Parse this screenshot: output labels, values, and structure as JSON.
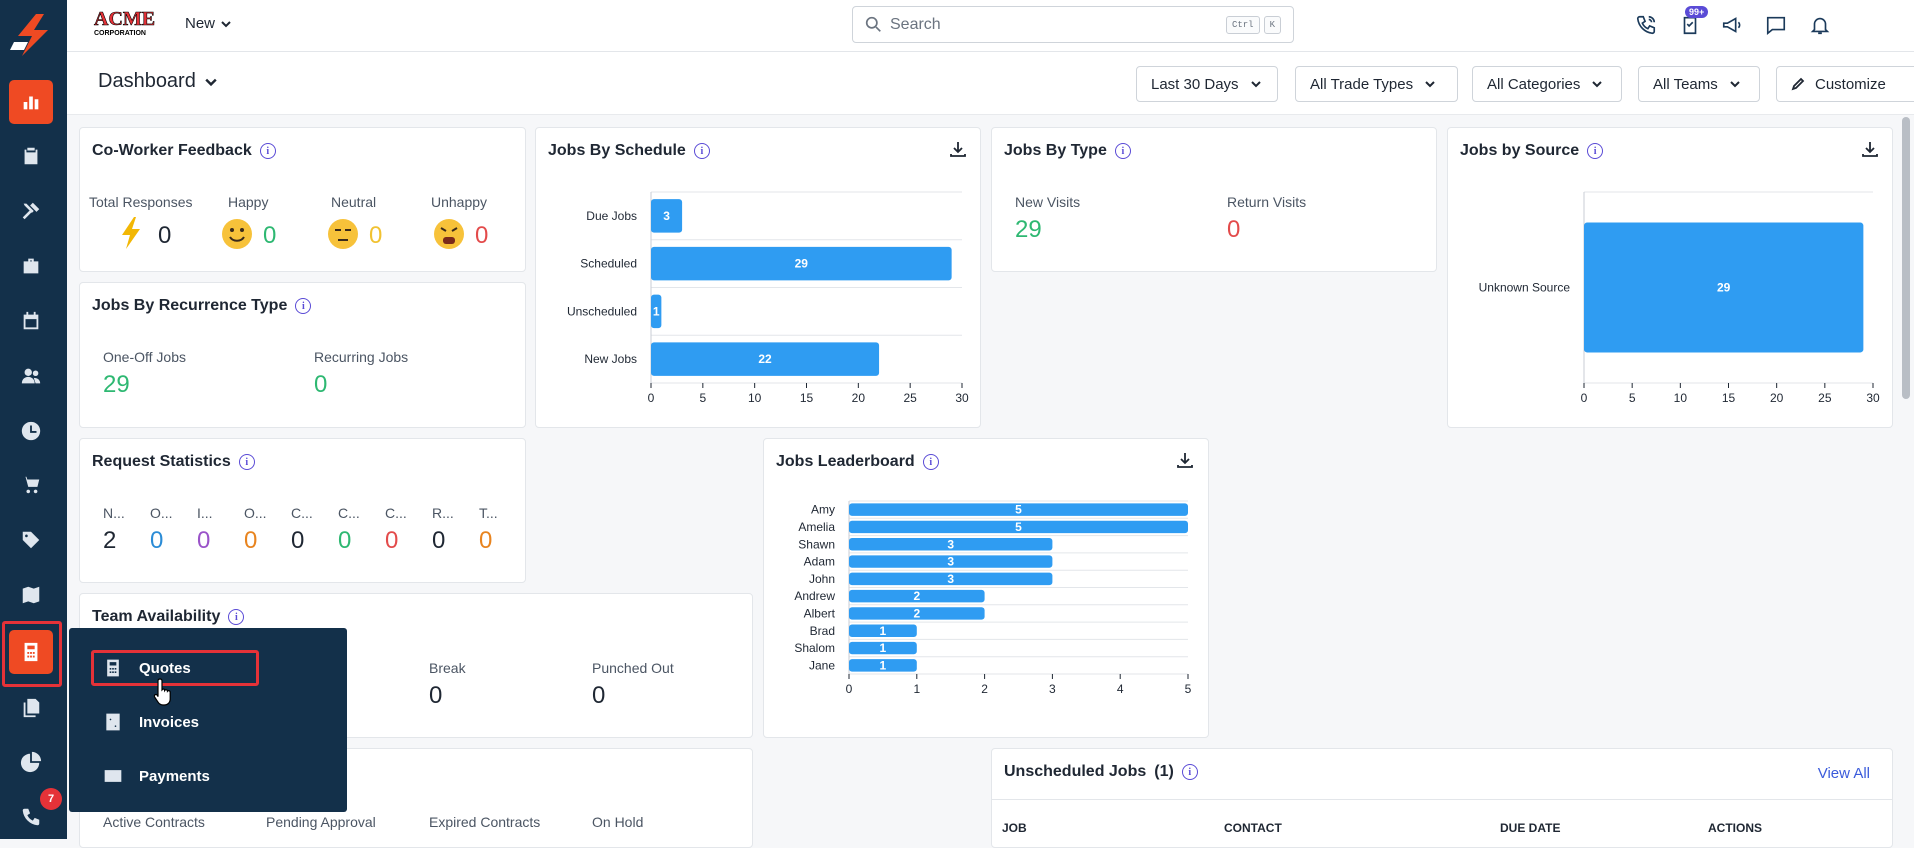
{
  "brand": {
    "logo_text": "ACME",
    "logo_sub": "CORPORATION",
    "new_label": "New"
  },
  "search": {
    "placeholder": "Search",
    "kbd1": "Ctrl",
    "kbd2": "K"
  },
  "topbar": {
    "tasks_badge": "99+"
  },
  "sidebar": {
    "phone_badge": "7"
  },
  "dashboard": {
    "title": "Dashboard"
  },
  "filters": {
    "date": "Last 30 Days",
    "trade": "All Trade Types",
    "category": "All Categories",
    "teams": "All Teams",
    "customize": "Customize"
  },
  "coworker": {
    "title": "Co-Worker Feedback",
    "total_label": "Total Responses",
    "total_value": "0",
    "happy_label": "Happy",
    "happy_value": "0",
    "neutral_label": "Neutral",
    "neutral_value": "0",
    "unhappy_label": "Unhappy",
    "unhappy_value": "0"
  },
  "recurrence": {
    "title": "Jobs By Recurrence Type",
    "oneoff_label": "One-Off Jobs",
    "oneoff_value": "29",
    "recurring_label": "Recurring Jobs",
    "recurring_value": "0"
  },
  "requests": {
    "title": "Request Statistics",
    "items": [
      {
        "label": "N...",
        "value": "2"
      },
      {
        "label": "O...",
        "value": "0"
      },
      {
        "label": "I...",
        "value": "0"
      },
      {
        "label": "O...",
        "value": "0"
      },
      {
        "label": "C...",
        "value": "0"
      },
      {
        "label": "C...",
        "value": "0"
      },
      {
        "label": "C...",
        "value": "0"
      },
      {
        "label": "R...",
        "value": "0"
      },
      {
        "label": "T...",
        "value": "0"
      }
    ]
  },
  "team_availability": {
    "title": "Team Availability",
    "break_label": "Break",
    "break_value": "0",
    "punched_label": "Punched Out",
    "punched_value": "0"
  },
  "contracts": {
    "active": "Active Contracts",
    "pending": "Pending Approval",
    "expired": "Expired Contracts",
    "hold": "On Hold"
  },
  "jobs_by_type": {
    "title": "Jobs By Type",
    "new_label": "New Visits",
    "new_value": "29",
    "return_label": "Return Visits",
    "return_value": "0"
  },
  "unscheduled": {
    "title": "Unscheduled Jobs",
    "count": "(1)",
    "view_all": "View All",
    "columns": [
      "JOB",
      "CONTACT",
      "DUE DATE",
      "ACTIONS"
    ]
  },
  "flyout": {
    "quotes": "Quotes",
    "invoices": "Invoices",
    "payments": "Payments"
  },
  "chart_data": [
    {
      "type": "bar",
      "orientation": "horizontal",
      "title": "Jobs By Schedule",
      "categories": [
        "Due Jobs",
        "Scheduled",
        "Unscheduled",
        "New Jobs"
      ],
      "values": [
        3,
        29,
        1,
        22
      ],
      "xlim": [
        0,
        30
      ],
      "ticks": [
        0,
        5,
        10,
        15,
        20,
        25,
        30
      ],
      "color": "#2f9cf2"
    },
    {
      "type": "bar",
      "orientation": "horizontal",
      "title": "Jobs by Source",
      "categories": [
        "Unknown Source"
      ],
      "values": [
        29
      ],
      "xlim": [
        0,
        30
      ],
      "ticks": [
        0,
        5,
        10,
        15,
        20,
        25,
        30
      ],
      "color": "#2f9cf2"
    },
    {
      "type": "bar",
      "orientation": "horizontal",
      "title": "Jobs Leaderboard",
      "categories": [
        "Amy",
        "Amelia",
        "Shawn",
        "Adam",
        "John",
        "Andrew",
        "Albert",
        "Brad",
        "Shalom",
        "Jane"
      ],
      "values": [
        5,
        5,
        3,
        3,
        3,
        2,
        2,
        1,
        1,
        1
      ],
      "xlim": [
        0,
        5
      ],
      "ticks": [
        0,
        1,
        2,
        3,
        4,
        5
      ],
      "color": "#2f9cf2"
    }
  ]
}
